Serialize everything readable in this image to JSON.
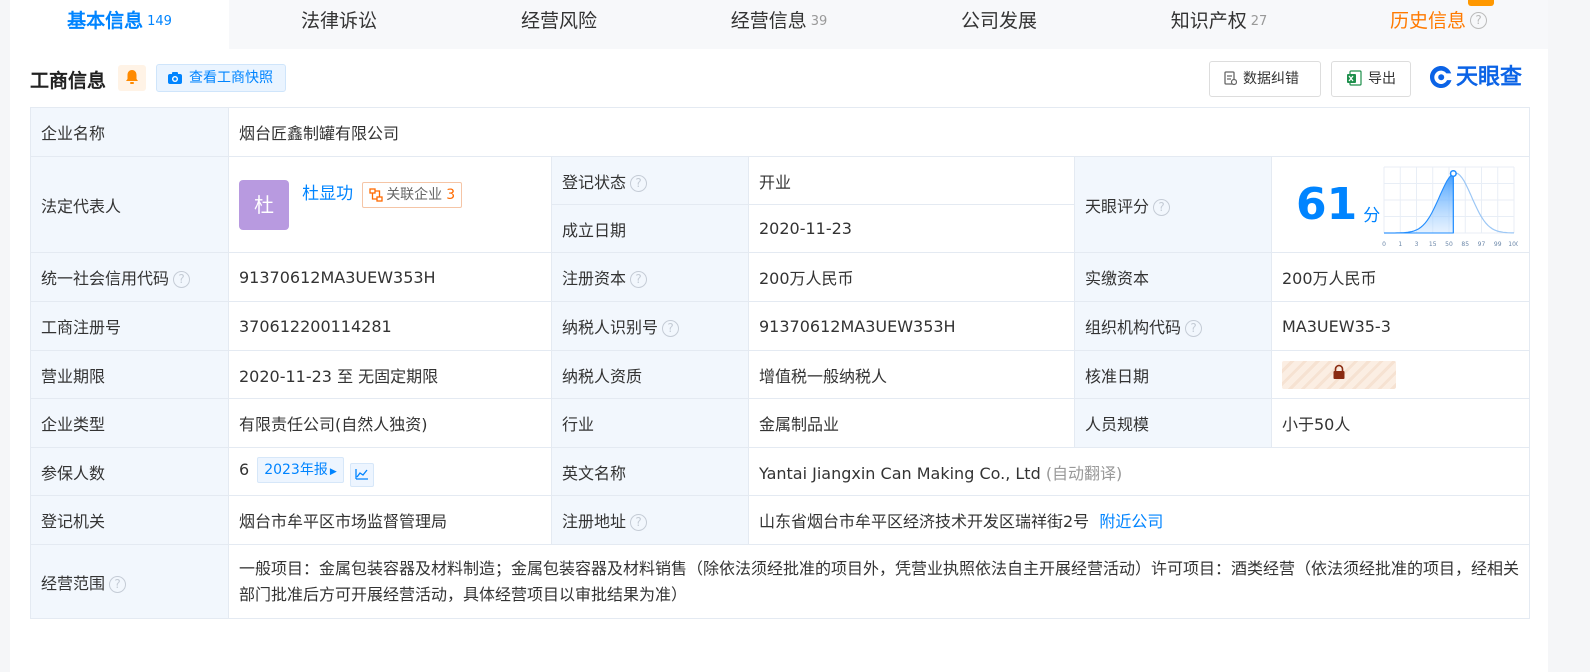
{
  "tabs": [
    {
      "label": "基本信息",
      "count": "149"
    },
    {
      "label": "法律诉讼",
      "count": ""
    },
    {
      "label": "经营风险",
      "count": ""
    },
    {
      "label": "经营信息",
      "count": "39"
    },
    {
      "label": "公司发展",
      "count": ""
    },
    {
      "label": "知识产权",
      "count": "27"
    },
    {
      "label": "历史信息",
      "count": ""
    }
  ],
  "header": {
    "title": "工商信息",
    "snapshot_label": "查看工商快照",
    "correct_label": "数据纠错",
    "export_label": "导出",
    "logo_text": "天眼查"
  },
  "colors": {
    "accent": "#0084ff",
    "active_status": "#0a9f4a",
    "history": "#ff7a00"
  },
  "info": {
    "company_name_label": "企业名称",
    "company_name": "烟台匠鑫制罐有限公司",
    "legal_rep_label": "法定代表人",
    "avatar_char": "杜",
    "legal_rep": "杜显功",
    "related_label": "关联企业",
    "related_count": "3",
    "reg_status_label": "登记状态",
    "reg_status": "开业",
    "found_date_label": "成立日期",
    "found_date": "2020-11-23",
    "score_label": "天眼评分",
    "score": "61",
    "score_unit": "分",
    "score_axis": [
      "0",
      "1",
      "3",
      "15",
      "50",
      "85",
      "97",
      "99",
      "100"
    ],
    "credit_code_label": "统一社会信用代码",
    "credit_code": "91370612MA3UEW353H",
    "reg_capital_label": "注册资本",
    "reg_capital": "200万人民币",
    "paid_capital_label": "实缴资本",
    "paid_capital": "200万人民币",
    "reg_no_label": "工商注册号",
    "reg_no": "370612200114281",
    "tax_id_label": "纳税人识别号",
    "tax_id": "91370612MA3UEW353H",
    "org_code_label": "组织机构代码",
    "org_code": "MA3UEW35-3",
    "term_label": "营业期限",
    "term": "2020-11-23 至 无固定期限",
    "taxpayer_label": "纳税人资质",
    "taxpayer": "增值税一般纳税人",
    "approve_label": "核准日期",
    "type_label": "企业类型",
    "type": "有限责任公司(自然人独资)",
    "industry_label": "行业",
    "industry": "金属制品业",
    "staff_label": "人员规模",
    "staff": "小于50人",
    "insured_label": "参保人数",
    "insured": "6",
    "report_label": "2023年报",
    "en_name_label": "英文名称",
    "en_name": "Yantai Jiangxin Can Making Co., Ltd",
    "auto_translate": "(自动翻译)",
    "authority_label": "登记机关",
    "authority": "烟台市牟平区市场监督管理局",
    "address_label": "注册地址",
    "address": "山东省烟台市牟平区经济技术开发区瑞祥街2号",
    "nearby_label": "附近公司",
    "scope_label": "经营范围",
    "scope": "一般项目：金属包装容器及材料制造；金属包装容器及材料销售（除依法须经批准的项目外，凭营业执照依法自主开展经营活动）许可项目：酒类经营（依法须经批准的项目，经相关部门批准后方可开展经营活动，具体经营项目以审批结果为准）"
  }
}
